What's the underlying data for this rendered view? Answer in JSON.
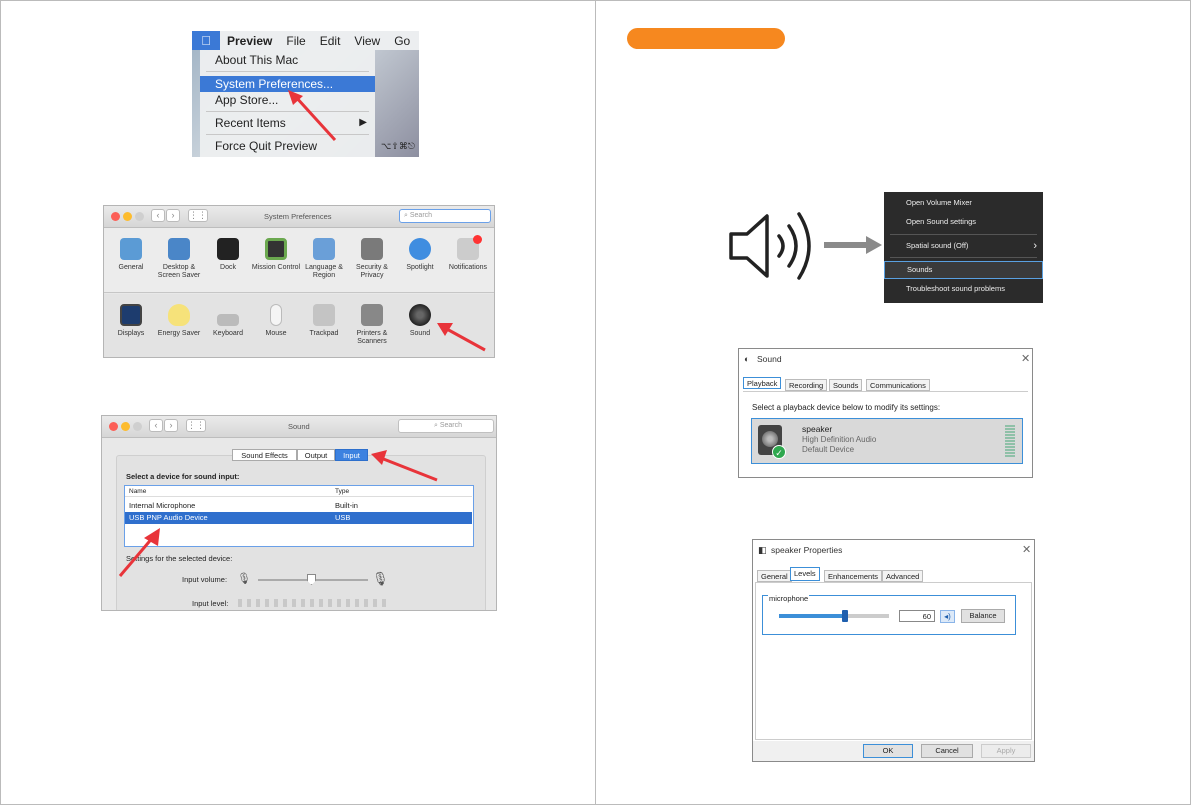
{
  "mac_menu": {
    "menubar": [
      "Preview",
      "File",
      "Edit",
      "View",
      "Go"
    ],
    "items": {
      "about": "About This Mac",
      "system_prefs": "System Preferences...",
      "app_store": "App Store...",
      "recent": "Recent Items",
      "recent_arrow": "▶",
      "force_quit": "Force Quit Preview",
      "force_quit_shortcut": "⌥⇧⌘⎋"
    }
  },
  "sysprefs": {
    "title": "System Preferences",
    "search": "Search",
    "row1": [
      "General",
      "Desktop & Screen Saver",
      "Dock",
      "Mission Control",
      "Language & Region",
      "Security & Privacy",
      "Spotlight",
      "Notifications"
    ],
    "row2": [
      "Displays",
      "Energy Saver",
      "Keyboard",
      "Mouse",
      "Trackpad",
      "Printers & Scanners",
      "Sound"
    ]
  },
  "sound_mac": {
    "title": "Sound",
    "search": "Search",
    "tabs": [
      "Sound Effects",
      "Output",
      "Input"
    ],
    "select_label": "Select a device for sound input:",
    "col_name": "Name",
    "col_type": "Type",
    "rows": [
      {
        "name": "Internal Microphone",
        "type": "Built-in"
      },
      {
        "name": "USB PNP Audio Device",
        "type": "USB"
      }
    ],
    "settings_label": "Settings for the selected device:",
    "input_volume": "Input volume:",
    "input_level": "Input level:"
  },
  "win_context": {
    "items": [
      "Open Volume Mixer",
      "Open Sound settings",
      "Spatial sound (Off)",
      "Sounds",
      "Troubleshoot sound problems"
    ],
    "spatial_arrow": "›"
  },
  "win_sound": {
    "title": "Sound",
    "tabs": [
      "Playback",
      "Recording",
      "Sounds",
      "Communications"
    ],
    "instruction": "Select a playback device below to modify its settings:",
    "device_name": "speaker",
    "device_desc": "High Definition Audio",
    "device_status": "Default Device",
    "close": "✕"
  },
  "win_props": {
    "title": "speaker Properties",
    "tabs": [
      "General",
      "Levels",
      "Enhancements",
      "Advanced"
    ],
    "group_label": "microphone",
    "level_value": "60",
    "level_fraction": 0.6,
    "balance": "Balance",
    "ok": "OK",
    "cancel": "Cancel",
    "apply": "Apply",
    "close": "✕"
  },
  "colors": {
    "accent_orange": "#f6881f",
    "mac_blue": "#3b79d6",
    "arrow_red": "#e8343a",
    "win_blue": "#3c8fd8"
  }
}
